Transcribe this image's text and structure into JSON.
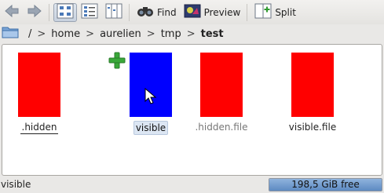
{
  "toolbar": {
    "find_label": "Find",
    "preview_label": "Preview",
    "split_label": "Split"
  },
  "breadcrumb": {
    "root": "/",
    "separator": ">",
    "items": [
      "home",
      "aurelien",
      "tmp",
      "test"
    ]
  },
  "files": [
    {
      "name": ".hidden",
      "color": "#ff0000"
    },
    {
      "name": "visible",
      "color": "#0000ff"
    },
    {
      "name": ".hidden.file",
      "color": "#ff0000"
    },
    {
      "name": "visible.file",
      "color": "#ff0000"
    }
  ],
  "statusbar": {
    "text": "visible",
    "free_space": "198,5 GiB free"
  }
}
